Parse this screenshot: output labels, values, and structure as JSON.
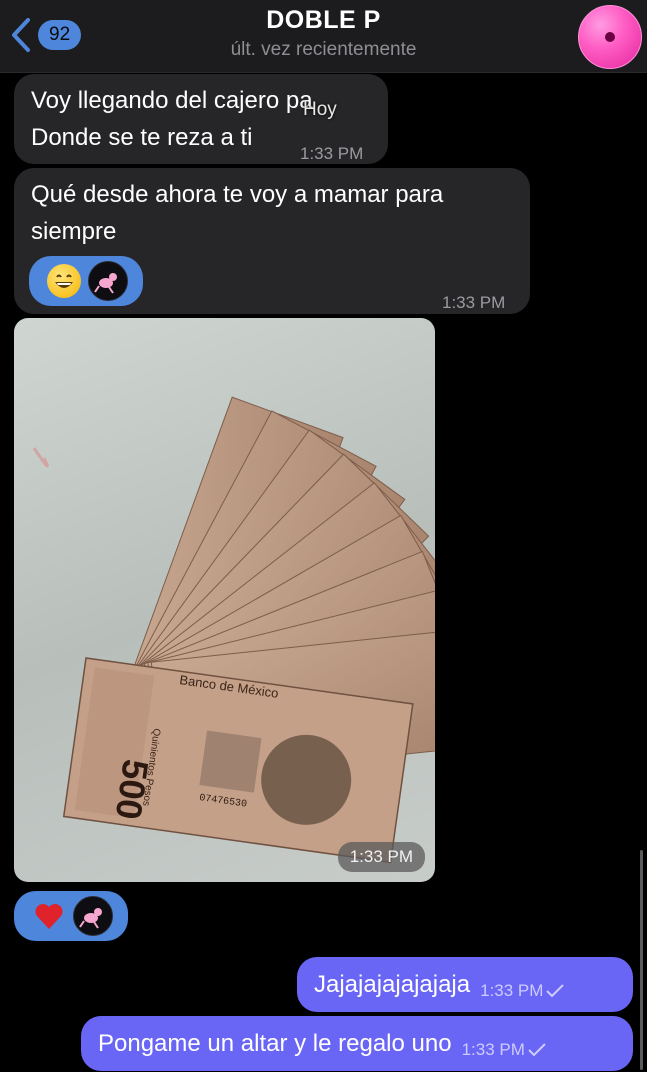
{
  "header": {
    "back_count": "92",
    "title": "DOBLE P",
    "subtitle": "últ. vez recientemente"
  },
  "date_label": "Hoy",
  "messages": [
    {
      "direction": "in",
      "lines": [
        "Voy llegando del cajero pa",
        "Donde se te reza a ti"
      ],
      "time": "1:33 PM"
    },
    {
      "direction": "in",
      "lines": [
        "Qué desde ahora te voy a mamar para",
        "siempre"
      ],
      "time": "1:33 PM",
      "reactions": [
        "grinning-face-emoji",
        "pink-panther-avatar"
      ]
    },
    {
      "direction": "in",
      "type": "photo",
      "alt_icon": "banknotes-500-pesos-photo",
      "printed_text": [
        "Banco de México",
        "500",
        "Quinientos Pesos",
        "07476530"
      ],
      "time": "1:33 PM",
      "reactions": [
        "red-heart-emoji",
        "pink-panther-avatar"
      ]
    },
    {
      "direction": "out",
      "text": "Jajajajajajajaja",
      "time": "1:33 PM",
      "status": "sent-check"
    },
    {
      "direction": "out",
      "text": "Pongame un altar y le regalo uno",
      "time": "1:33 PM",
      "status": "sent-check"
    }
  ],
  "colors": {
    "outgoing_bubble": "#6a66f5",
    "incoming_bubble": "#262628",
    "accent": "#4e86dc",
    "background": "#000000"
  }
}
